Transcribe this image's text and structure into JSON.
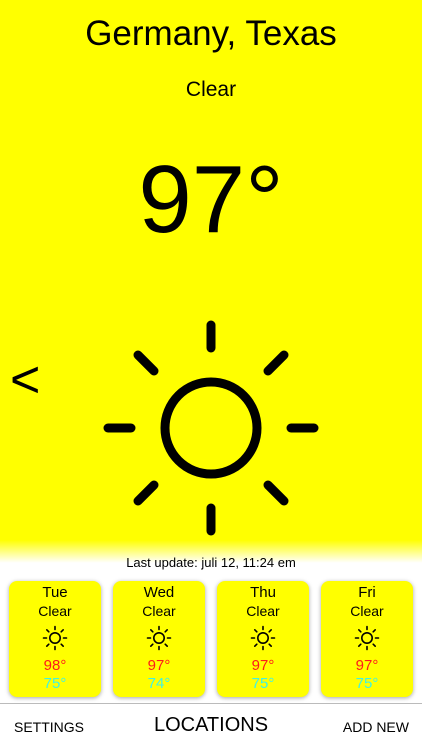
{
  "location": "Germany, Texas",
  "condition": "Clear",
  "temperature": "97°",
  "back_label": "<",
  "current_icon": "sun-icon",
  "last_update": "Last update: juli 12, 11:24 em",
  "forecast": [
    {
      "day": "Tue",
      "condition": "Clear",
      "icon": "sun-icon",
      "high": "98°",
      "low": "75°"
    },
    {
      "day": "Wed",
      "condition": "Clear",
      "icon": "sun-icon",
      "high": "97°",
      "low": "74°"
    },
    {
      "day": "Thu",
      "condition": "Clear",
      "icon": "sun-icon",
      "high": "97°",
      "low": "75°"
    },
    {
      "day": "Fri",
      "condition": "Clear",
      "icon": "sun-icon",
      "high": "97°",
      "low": "75°"
    }
  ],
  "bottom_bar": {
    "settings": "SETTINGS",
    "locations": "LOCATIONS",
    "add_new": "ADD NEW"
  },
  "colors": {
    "background": "#ffff00",
    "high_temp": "#ff1a1a",
    "low_temp": "#3ff2e6"
  }
}
